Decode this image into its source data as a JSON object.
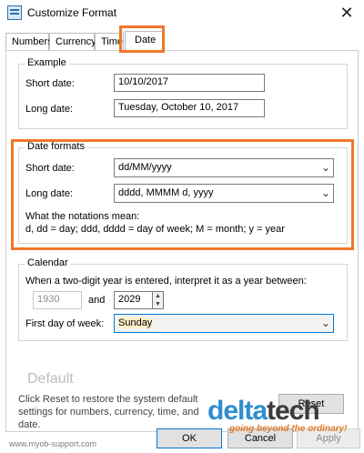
{
  "window": {
    "title": "Customize Format",
    "close_glyph": "✕"
  },
  "tabs": [
    {
      "label": "Numbers"
    },
    {
      "label": "Currency"
    },
    {
      "label": "Time"
    },
    {
      "label": "Date",
      "active": true
    }
  ],
  "example": {
    "group_label": "Example",
    "short_label": "Short date:",
    "short_value": "10/10/2017",
    "long_label": "Long date:",
    "long_value": "Tuesday, October 10, 2017"
  },
  "date_formats": {
    "group_label": "Date formats",
    "short_label": "Short date:",
    "short_value": "dd/MM/yyyy",
    "long_label": "Long date:",
    "long_value": "dddd, MMMM d, yyyy",
    "notation_title": "What the notations mean:",
    "notation_text": "d, dd = day;  ddd, dddd = day of week;  M = month;  y = year"
  },
  "calendar": {
    "group_label": "Calendar",
    "two_digit_text": "When a two-digit year is entered, interpret it as a year between:",
    "year_from": "1930",
    "and_label": "and",
    "year_to": "2029",
    "first_day_label": "First day of week:",
    "first_day_value": "Sunday"
  },
  "footer": {
    "default_label": "Default",
    "reset_text": "Click Reset to restore the system default settings for numbers, currency, time, and date.",
    "reset_button": "Reset",
    "ok": "OK",
    "cancel": "Cancel",
    "apply": "Apply"
  },
  "watermark": "www.myob-support.com",
  "overlay": {
    "brand_part1": "delta",
    "brand_part2": "tech",
    "tagline": "going beyond the ordinary!"
  },
  "colors": {
    "highlight": "#f0782a",
    "brand_blue": "#2f8dd0"
  }
}
